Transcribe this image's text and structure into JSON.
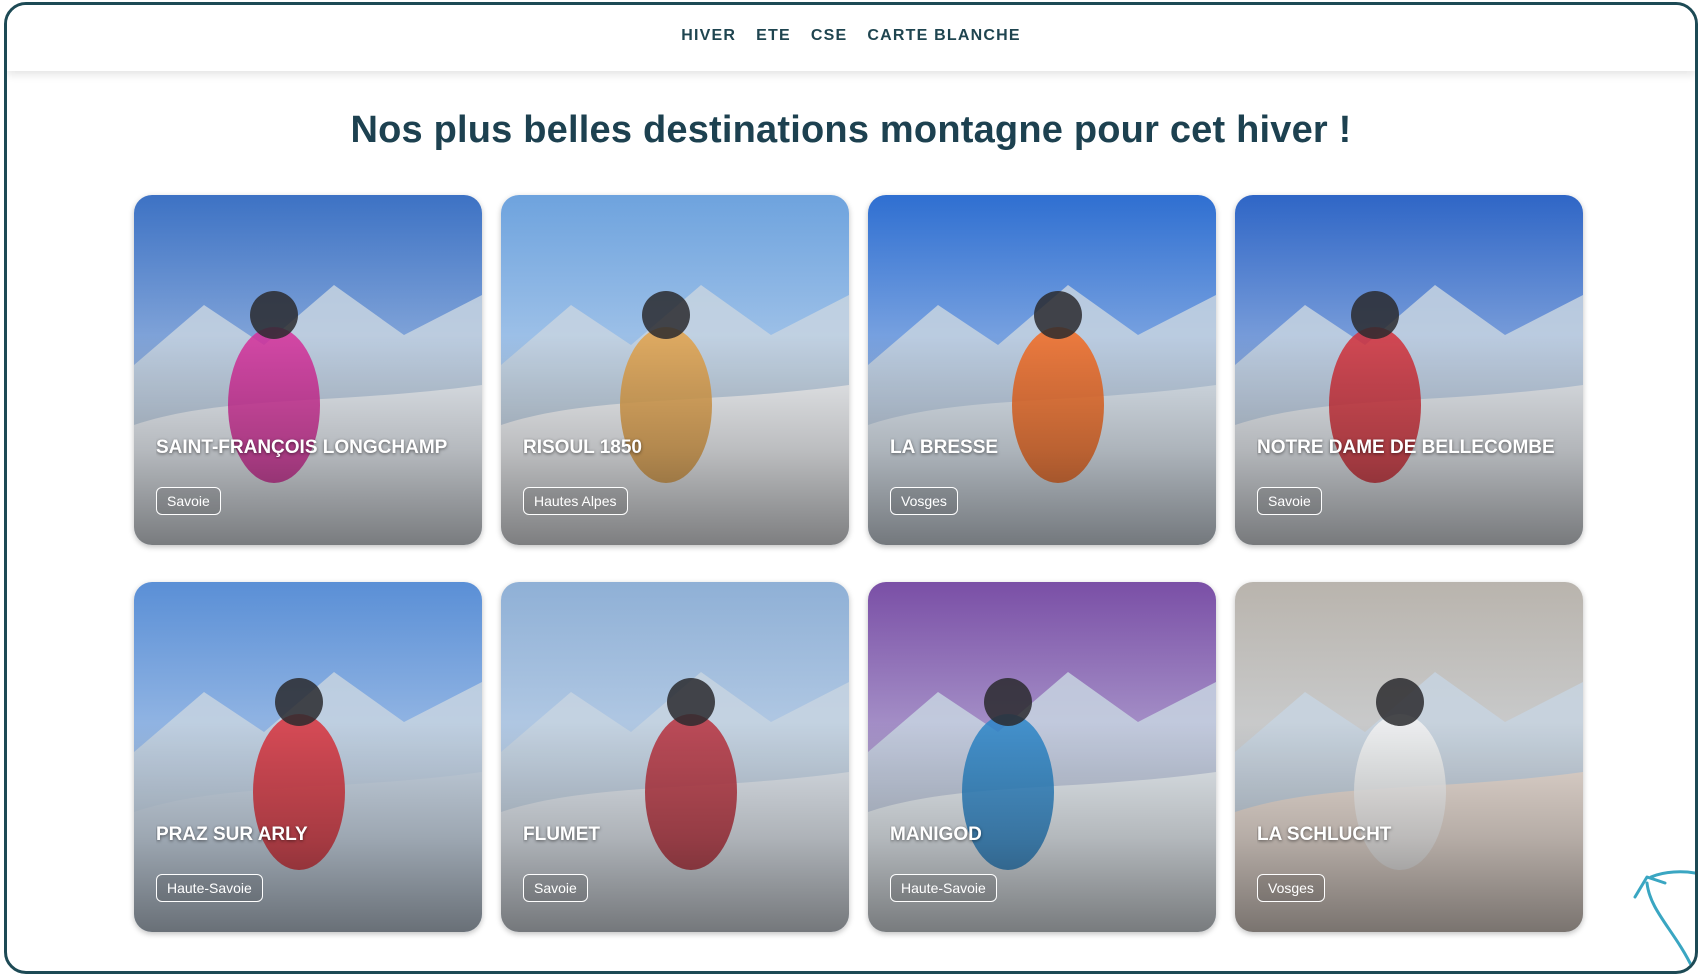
{
  "nav": {
    "items": [
      "HIVER",
      "ETE",
      "CSE",
      "CARTE BLANCHE"
    ]
  },
  "heading": "Nos plus belles destinations montagne pour cet hiver !",
  "cards": [
    {
      "title": "SAINT-FRANÇOIS LONGCHAMP",
      "region": "Savoie",
      "sky": "#3d72c4",
      "ground": "#e8edf3",
      "accent": "#d62f9a"
    },
    {
      "title": "RISOUL 1850",
      "region": "Hautes Alpes",
      "sky": "#6ea3de",
      "ground": "#f0f2f5",
      "accent": "#e2a24a"
    },
    {
      "title": "LA BRESSE",
      "region": "Vosges",
      "sky": "#2f6fd1",
      "ground": "#dde6ef",
      "accent": "#f26a21"
    },
    {
      "title": "NOTRE DAME DE BELLECOMBE",
      "region": "Savoie",
      "sky": "#2f66c6",
      "ground": "#e5e9ee",
      "accent": "#d3303a"
    },
    {
      "title": "PRAZ SUR ARLY",
      "region": "Haute-Savoie",
      "sky": "#5a8fd6",
      "ground": "#c9d6e4",
      "accent": "#d8323c"
    },
    {
      "title": "FLUMET",
      "region": "Savoie",
      "sky": "#8fb0d6",
      "ground": "#dfe5ec",
      "accent": "#b8323e"
    },
    {
      "title": "MANIGOD",
      "region": "Haute-Savoie",
      "sky": "#7a4fa6",
      "ground": "#e6ecf1",
      "accent": "#2d86c8"
    },
    {
      "title": "LA SCHLUCHT",
      "region": "Vosges",
      "sky": "#b9b4ad",
      "ground": "#e9ddd5",
      "accent": "#f2f2f2"
    }
  ],
  "colors": {
    "frame": "#1d4a55",
    "heading": "#1d4150",
    "arrow": "#3aa6c2"
  }
}
